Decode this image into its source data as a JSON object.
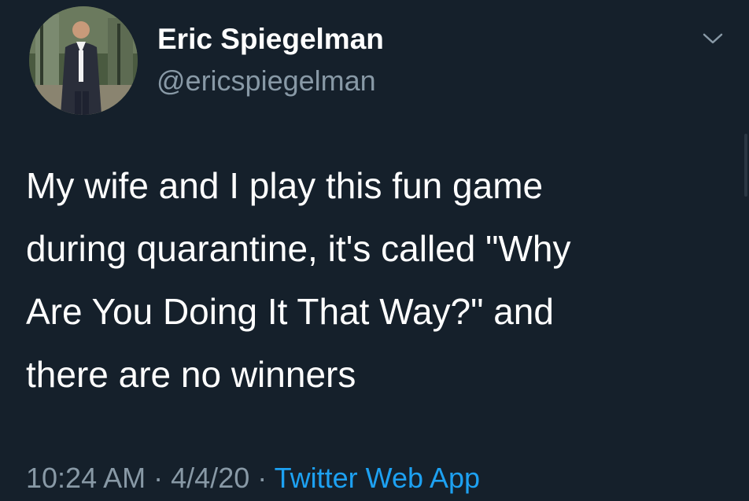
{
  "author": {
    "display_name": "Eric Spiegelman",
    "handle": "@ericspiegelman",
    "avatar_icon": "profile-photo"
  },
  "tweet": {
    "lines": [
      "My wife and I play this fun game",
      "during quarantine, it's called \"Why",
      "Are You Doing It That Way?\" and",
      "there are no winners"
    ]
  },
  "meta": {
    "time": "10:24 AM",
    "separator": "·",
    "date": "4/4/20",
    "source": "Twitter Web App"
  },
  "icons": {
    "menu": "chevron-down-icon"
  },
  "colors": {
    "background": "#15202b",
    "text": "#ffffff",
    "secondary": "#8899a6",
    "link": "#1da1f2"
  }
}
